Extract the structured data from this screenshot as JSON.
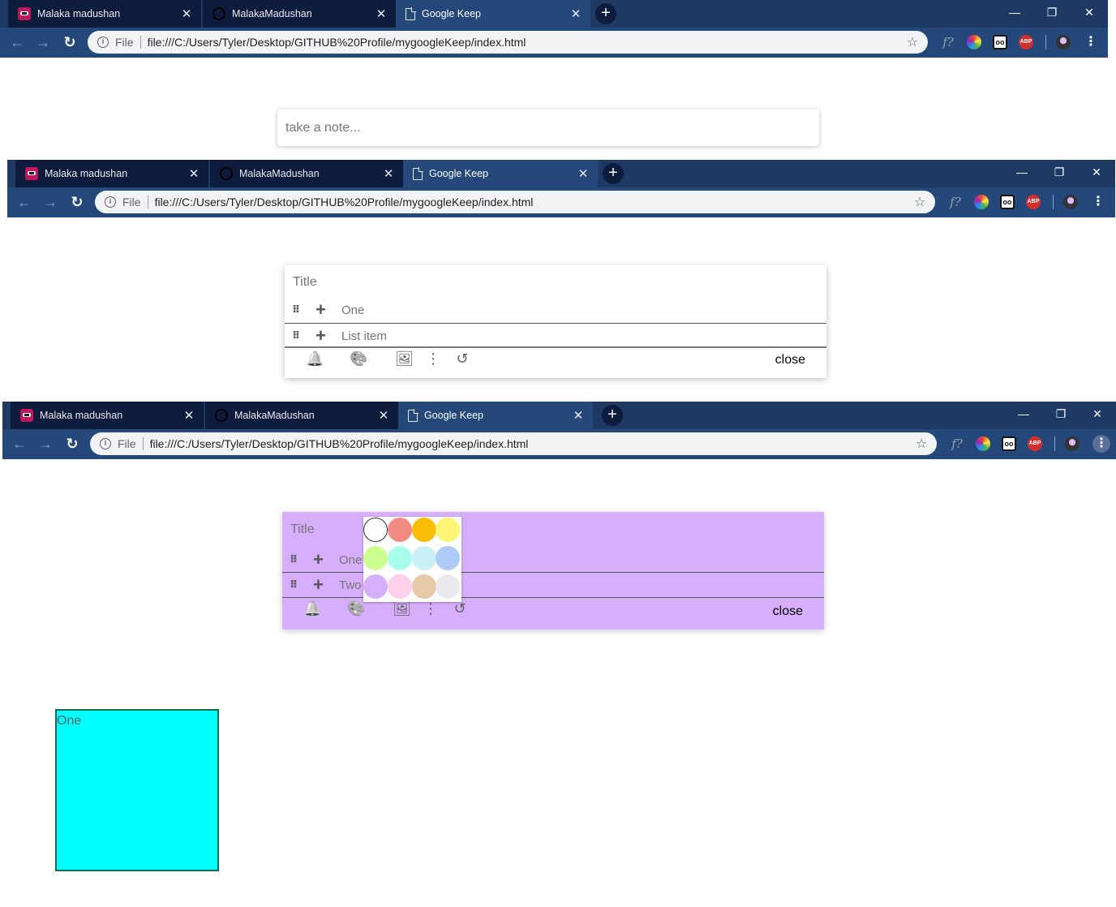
{
  "browser": {
    "tabs": [
      {
        "label": "Malaka madushan",
        "favicon": "angry-bird-icon"
      },
      {
        "label": "MalakaMadushan",
        "favicon": "github-icon"
      },
      {
        "label": "Google Keep",
        "favicon": "document-icon"
      }
    ],
    "tab_close_glyph": "✕",
    "new_tab_glyph": "+",
    "window_controls": {
      "minimize": "—",
      "restore": "❐",
      "close": "✕"
    },
    "nav": {
      "back": "←",
      "forward": "→",
      "reload": "↻"
    },
    "omnibox": {
      "info": "i",
      "scheme_label": "File",
      "url": "file:///C:/Users/Tyler/Desktop/GITHUB%20Profile/mygoogleKeep/index.html",
      "star": "☆"
    },
    "extensions": {
      "font_finder": "f?",
      "oo": "oo",
      "abp": "ABP",
      "menu": "⋮"
    },
    "colors": {
      "tabstrip": "#1e3a64",
      "toolbar": "#24487a",
      "inactive_tab": "#0d1b3c"
    }
  },
  "screen1": {
    "take_note_placeholder": "take a note..."
  },
  "screen2": {
    "title_placeholder": "Title",
    "items": [
      "One",
      "List item"
    ],
    "close_label": "close"
  },
  "screen3": {
    "title_placeholder": "Title",
    "items": [
      "One",
      "Two"
    ],
    "close_label": "close",
    "note_color": "#d7aefb",
    "palette_colors": [
      "#ffffff",
      "#f28b82",
      "#fbbc04",
      "#fff475",
      "#ccff90",
      "#a7ffeb",
      "#cbf0f8",
      "#aecbfa",
      "#d7aefb",
      "#fdcfe8",
      "#e6c9a8",
      "#e8eaed"
    ]
  },
  "icons": {
    "grip": "⠿",
    "plus": "+",
    "bell": "🔔",
    "palette": "🎨",
    "image": "🖼",
    "more": "⋮",
    "undo": "↺"
  },
  "saved_note": {
    "text": "One",
    "color": "#00ffff"
  }
}
